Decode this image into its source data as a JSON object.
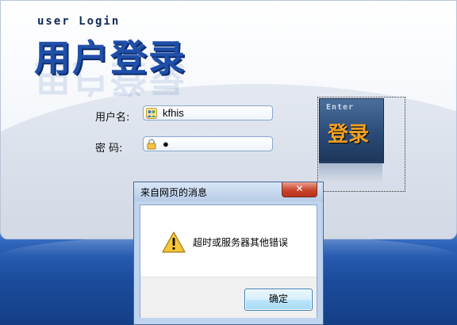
{
  "header": {
    "subtitle": "user Login",
    "logo_text": "用户登录"
  },
  "form": {
    "username_label": "用户名:",
    "username_value": "kfhis",
    "password_label": "密  码:",
    "password_value": "●"
  },
  "enter_button": {
    "english": "Enter",
    "chinese": "登录"
  },
  "dialog": {
    "title": "来自网页的消息",
    "close_glyph": "✕",
    "message": "超时或服务器其他错误",
    "ok_label": "确定"
  },
  "colors": {
    "accent_blue": "#1f4fa8",
    "background_blue": "#1c4d96",
    "enter_text": "#f4a11f"
  }
}
